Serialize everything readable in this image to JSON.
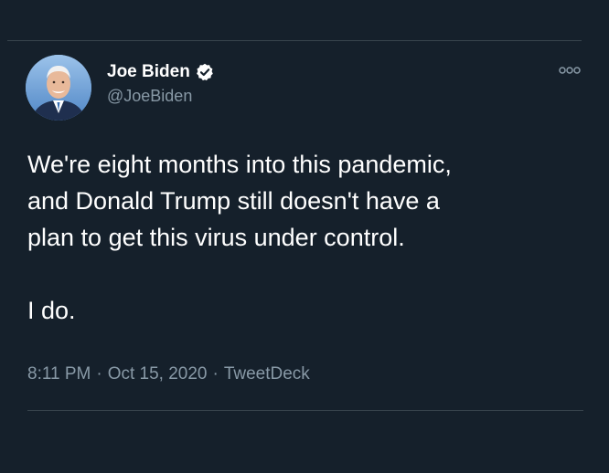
{
  "tweet": {
    "author": {
      "name": "Joe Biden",
      "handle": "@JoeBiden"
    },
    "text_lines": [
      "We're eight months into this pandemic,",
      "and Donald Trump still doesn't have a",
      "plan to get this virus under control."
    ],
    "text_second_paragraph": "I do.",
    "time": "8:11 PM",
    "date": "Oct 15, 2020",
    "source": "TweetDeck",
    "separator": "·"
  },
  "icons": {
    "verified": "verified-badge-icon",
    "more": "more-options-icon"
  },
  "colors": {
    "background": "#15202b",
    "text": "#ffffff",
    "secondary_text": "#8899a6",
    "divider": "#38444d"
  }
}
